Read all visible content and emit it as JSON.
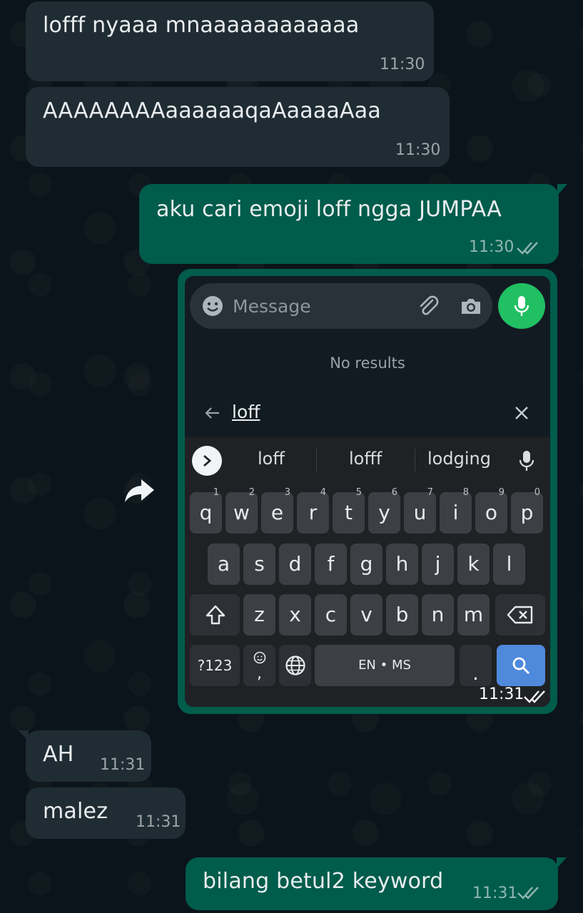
{
  "messages": [
    {
      "direction": "in",
      "text": "lofff nyaaa mnaaaaaaaaaaaa",
      "time": "11:30"
    },
    {
      "direction": "in",
      "text": "AAAAAAAAaaaaaaqaAaaaaAaa",
      "time": "11:30"
    },
    {
      "direction": "out",
      "text": "aku cari emoji loff ngga JUMPAA",
      "time": "11:30",
      "status": "read"
    },
    {
      "direction": "out",
      "type": "image",
      "time": "11:31",
      "status": "read"
    },
    {
      "direction": "in",
      "text": "AH",
      "time": "11:31"
    },
    {
      "direction": "in",
      "text": "malez",
      "time": "11:31"
    },
    {
      "direction": "out",
      "text": "bilang betul2 keyword",
      "time": "11:31",
      "status": "read"
    }
  ],
  "screenshot": {
    "composer_placeholder": "Message",
    "no_results": "No results",
    "search_query": "loff",
    "suggestions": [
      "loff",
      "lofff",
      "lodging"
    ],
    "keys_row1": [
      "q",
      "w",
      "e",
      "r",
      "t",
      "y",
      "u",
      "i",
      "o",
      "p"
    ],
    "keys_row1_hints": [
      "1",
      "2",
      "3",
      "4",
      "5",
      "6",
      "7",
      "8",
      "9",
      "0"
    ],
    "keys_row2": [
      "a",
      "s",
      "d",
      "f",
      "g",
      "h",
      "j",
      "k",
      "l"
    ],
    "keys_row3": [
      "z",
      "x",
      "c",
      "v",
      "b",
      "n",
      "m"
    ],
    "symbols_key": "?123",
    "comma_key": ",",
    "space_label": "EN • MS",
    "period_key": "."
  },
  "icons": {
    "read_receipt": "double-check-icon",
    "forward": "forward-icon",
    "emoji": "emoji-icon",
    "attach": "paperclip-icon",
    "camera": "camera-icon",
    "mic": "mic-icon",
    "search": "search-icon",
    "backspace": "backspace-icon",
    "shift": "shift-icon",
    "globe": "globe-icon"
  },
  "colors": {
    "background": "#0b141a",
    "incoming_bubble": "#202c33",
    "outgoing_bubble": "#005c4b",
    "mic_button": "#21c063",
    "search_key": "#4f89dc"
  }
}
